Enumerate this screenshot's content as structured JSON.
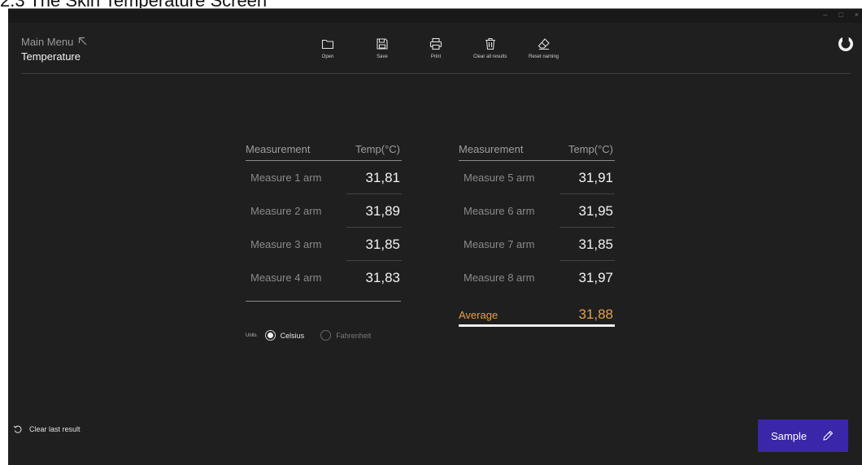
{
  "doc_heading": "2.3 The Skin Temperature Screen",
  "window_controls": {
    "minimize": "–",
    "maximize": "□",
    "close": "×"
  },
  "breadcrumb": {
    "parent": "Main Menu",
    "current": "Temperature"
  },
  "toolbar": {
    "items": [
      {
        "label": "Open",
        "icon": "folder-icon"
      },
      {
        "label": "Save",
        "icon": "floppy-icon"
      },
      {
        "label": "Print",
        "icon": "printer-icon"
      },
      {
        "label": "Clear all results",
        "icon": "trash-icon"
      },
      {
        "label": "Reset naming",
        "icon": "eraser-icon"
      }
    ]
  },
  "table": {
    "headers": {
      "measurement": "Measurement",
      "temp": "Temp(°C)"
    },
    "left": [
      {
        "name": "Measure 1 arm",
        "value": "31,81"
      },
      {
        "name": "Measure 2 arm",
        "value": "31,89"
      },
      {
        "name": "Measure 3 arm",
        "value": "31,85"
      },
      {
        "name": "Measure 4 arm",
        "value": "31,83"
      }
    ],
    "right": [
      {
        "name": "Measure 5 arm",
        "value": "31,91"
      },
      {
        "name": "Measure 6 arm",
        "value": "31,95"
      },
      {
        "name": "Measure 7 arm",
        "value": "31,85"
      },
      {
        "name": "Measure 8 arm",
        "value": "31,97"
      }
    ],
    "average": {
      "label": "Average",
      "value": "31,88"
    }
  },
  "units": {
    "label": "Units",
    "options": [
      "Celsius",
      "Fahrenheit"
    ],
    "selected": "Celsius"
  },
  "footer": {
    "clear_last": "Clear last result",
    "sample_button": "Sample"
  },
  "colors": {
    "background": "#1f1f1f",
    "accent": "#3a26a8",
    "average": "#e6a04a"
  }
}
